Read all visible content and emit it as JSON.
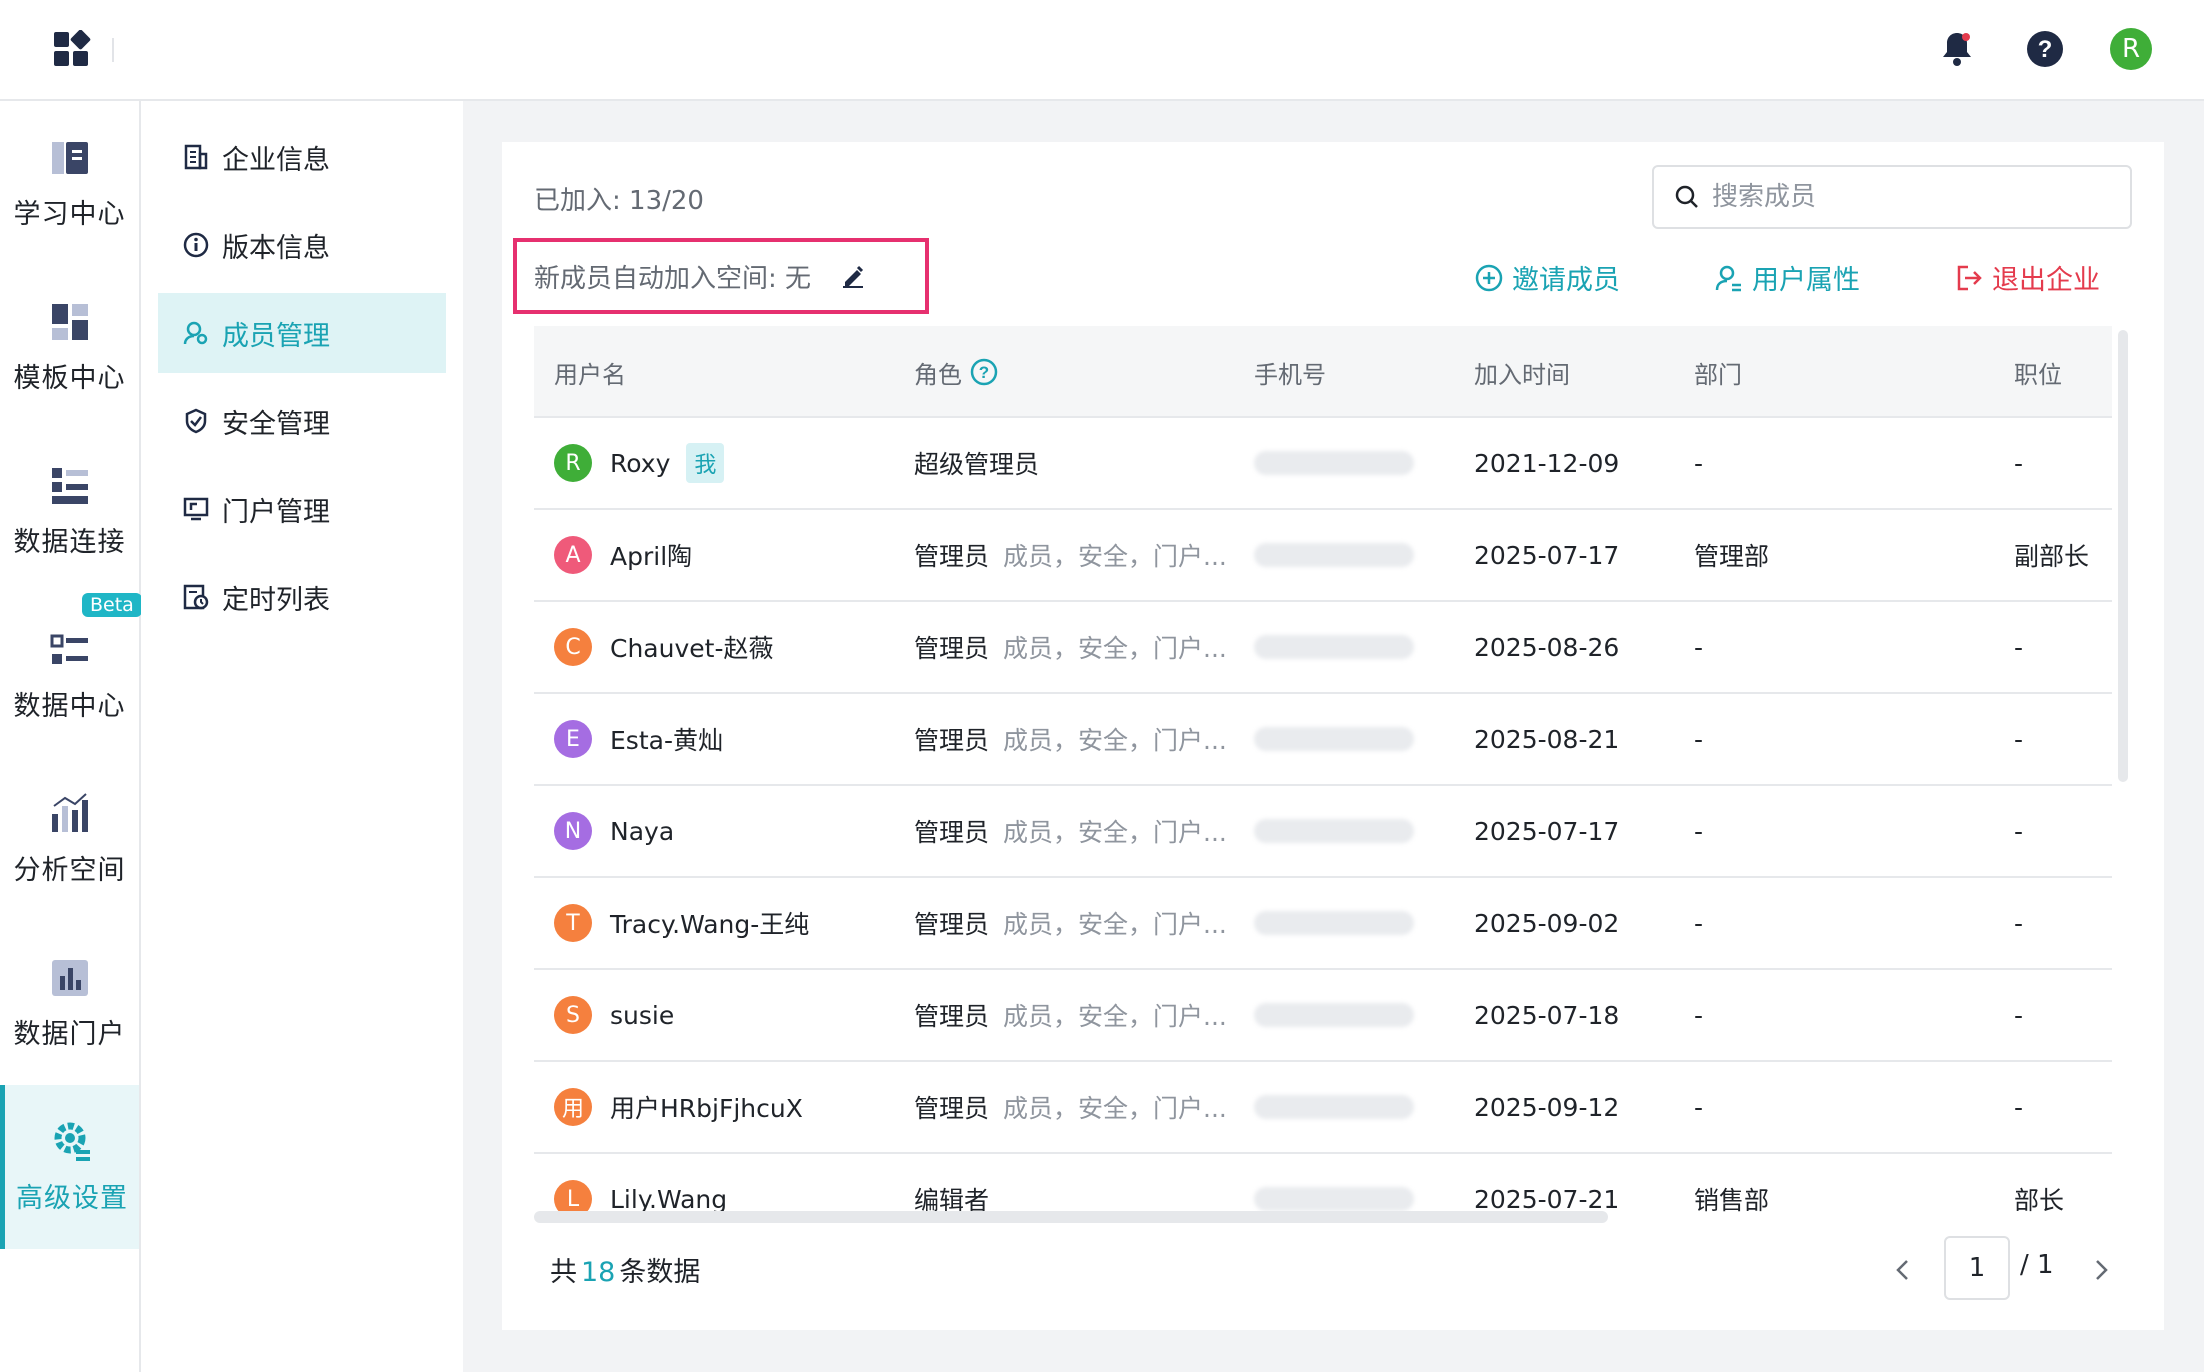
{
  "colors": {
    "accent": "#1aa3b3",
    "danger": "#e43b4d",
    "highlight_border": "#e6306f"
  },
  "topbar": {
    "icons": [
      "apps-logo-icon",
      "bell-icon",
      "help-icon"
    ],
    "avatar_letter": "R"
  },
  "primary_nav": [
    {
      "label": "学习中心",
      "icon": "book-icon"
    },
    {
      "label": "模板中心",
      "icon": "template-icon"
    },
    {
      "label": "数据连接",
      "icon": "data-connect-icon"
    },
    {
      "label": "数据中心",
      "icon": "data-center-icon",
      "badge": "Beta"
    },
    {
      "label": "分析空间",
      "icon": "analysis-icon"
    },
    {
      "label": "数据门户",
      "icon": "portal-chart-icon"
    },
    {
      "label": "高级设置",
      "icon": "gear-settings-icon",
      "active": true
    }
  ],
  "secondary_nav": [
    {
      "label": "企业信息",
      "icon": "building-icon"
    },
    {
      "label": "版本信息",
      "icon": "info-icon"
    },
    {
      "label": "成员管理",
      "icon": "member-icon",
      "active": true
    },
    {
      "label": "安全管理",
      "icon": "shield-icon"
    },
    {
      "label": "门户管理",
      "icon": "portal-icon"
    },
    {
      "label": "定时列表",
      "icon": "schedule-icon"
    }
  ],
  "main": {
    "joined_text": "已加入: 13/20",
    "search_placeholder": "搜索成员",
    "auto_join_text": "新成员自动加入空间: 无",
    "actions": {
      "invite": "邀请成员",
      "user_attr": "用户属性",
      "exit": "退出企业"
    }
  },
  "table": {
    "headers": {
      "username": "用户名",
      "role": "角色",
      "phone": "手机号",
      "join_time": "加入时间",
      "department": "部门",
      "position": "职位"
    },
    "rows": [
      {
        "avatar": "R",
        "avatar_color": "#3fae38",
        "name": "Roxy",
        "me_tag": "我",
        "role": "超级管理员",
        "role_extra": "",
        "date": "2021-12-09",
        "dept": "-",
        "pos": "-"
      },
      {
        "avatar": "A",
        "avatar_color": "#ef5a7a",
        "name": "April陶",
        "me_tag": "",
        "role": "管理员",
        "role_extra": "成员，安全，门户...",
        "date": "2025-07-17",
        "dept": "管理部",
        "pos": "副部长"
      },
      {
        "avatar": "C",
        "avatar_color": "#f5803e",
        "name": "Chauvet-赵薇",
        "me_tag": "",
        "role": "管理员",
        "role_extra": "成员，安全，门户...",
        "date": "2025-08-26",
        "dept": "-",
        "pos": "-"
      },
      {
        "avatar": "E",
        "avatar_color": "#a56de2",
        "name": "Esta-黄灿",
        "me_tag": "",
        "role": "管理员",
        "role_extra": "成员，安全，门户...",
        "date": "2025-08-21",
        "dept": "-",
        "pos": "-"
      },
      {
        "avatar": "N",
        "avatar_color": "#a56de2",
        "name": "Naya",
        "me_tag": "",
        "role": "管理员",
        "role_extra": "成员，安全，门户...",
        "date": "2025-07-17",
        "dept": "-",
        "pos": "-"
      },
      {
        "avatar": "T",
        "avatar_color": "#f5803e",
        "name": "Tracy.Wang-王纯",
        "me_tag": "",
        "role": "管理员",
        "role_extra": "成员，安全，门户...",
        "date": "2025-09-02",
        "dept": "-",
        "pos": "-"
      },
      {
        "avatar": "S",
        "avatar_color": "#f5803e",
        "name": "susie",
        "me_tag": "",
        "role": "管理员",
        "role_extra": "成员，安全，门户...",
        "date": "2025-07-18",
        "dept": "-",
        "pos": "-"
      },
      {
        "avatar": "用",
        "avatar_color": "#f5803e",
        "name": "用户HRbjFjhcuX",
        "me_tag": "",
        "role": "管理员",
        "role_extra": "成员，安全，门户...",
        "date": "2025-09-12",
        "dept": "-",
        "pos": "-"
      },
      {
        "avatar": "L",
        "avatar_color": "#f5803e",
        "name": "Lily.Wang",
        "me_tag": "",
        "role": "编辑者",
        "role_extra": "",
        "date": "2025-07-21",
        "dept": "销售部",
        "pos": "部长"
      }
    ]
  },
  "footer": {
    "total_prefix": "共",
    "total_count": "18",
    "total_suffix": "条数据",
    "current_page": "1",
    "total_pages": "/ 1"
  }
}
